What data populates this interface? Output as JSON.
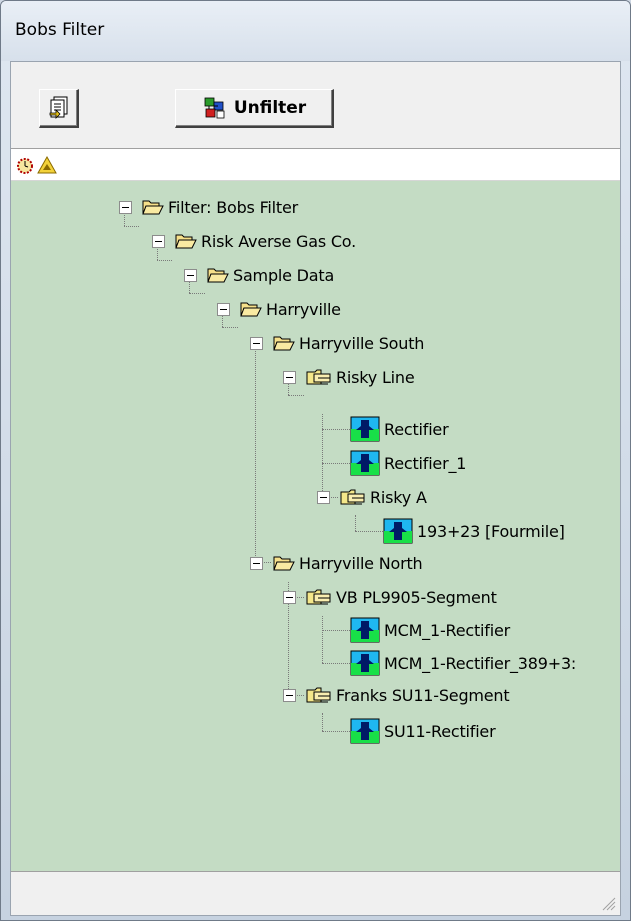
{
  "window": {
    "title": "Bobs Filter"
  },
  "toolbar": {
    "unfilter_label": "Unfilter"
  },
  "tree": {
    "nodes": [
      {
        "label": "Filter: Bobs Filter",
        "type": "folder-open"
      },
      {
        "label": "Risk Averse Gas Co.",
        "type": "folder-open"
      },
      {
        "label": "Sample Data",
        "type": "folder-open"
      },
      {
        "label": "Harryville",
        "type": "folder-open"
      },
      {
        "label": "Harryville South",
        "type": "folder-open"
      },
      {
        "label": "Risky Line",
        "type": "pipeline-folder"
      },
      {
        "label": "Rectifier",
        "type": "rectifier"
      },
      {
        "label": "Rectifier_1",
        "type": "rectifier"
      },
      {
        "label": "Risky A",
        "type": "pipeline-folder"
      },
      {
        "label": "193+23 [Fourmile]",
        "type": "rectifier"
      },
      {
        "label": "Harryville North",
        "type": "folder-open"
      },
      {
        "label": "VB PL9905-Segment",
        "type": "pipeline-folder"
      },
      {
        "label": "MCM_1-Rectifier",
        "type": "rectifier"
      },
      {
        "label": "MCM_1-Rectifier_389+3:",
        "type": "rectifier"
      },
      {
        "label": "Franks SU11-Segment",
        "type": "pipeline-folder"
      },
      {
        "label": "SU11-Rectifier",
        "type": "rectifier"
      }
    ]
  },
  "icons": {
    "properties": "properties-icon",
    "unfilter": "unfilter-icon",
    "alarm": "alarm-icon",
    "warning": "warning-icon"
  }
}
